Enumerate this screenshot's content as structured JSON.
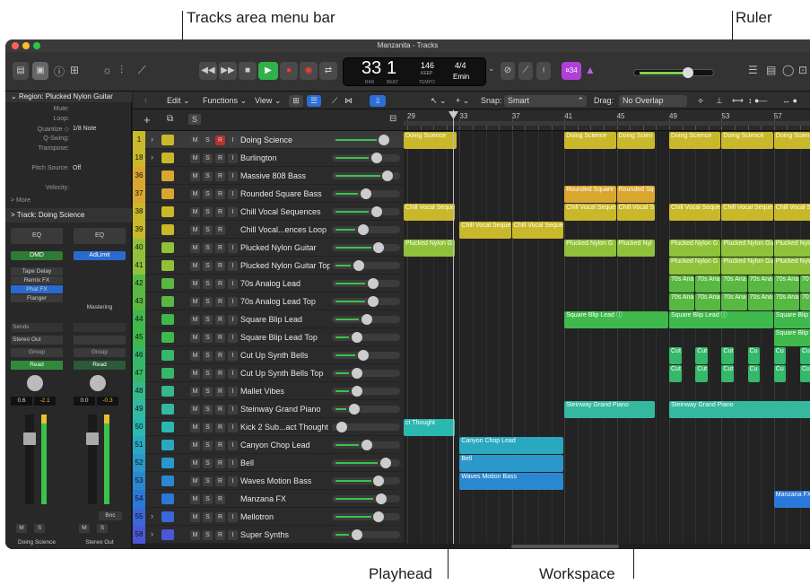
{
  "callouts": {
    "tracks_menu": "Tracks area menu bar",
    "ruler": "Ruler",
    "playhead": "Playhead",
    "workspace": "Workspace"
  },
  "window": {
    "title": "Manzanita - Tracks"
  },
  "lcd": {
    "bar": "33",
    "beat_pos": "1",
    "bar_label": "BAR",
    "beat_label": "BEAT",
    "tempo": "146",
    "tempo_mode": "KEEP",
    "tempo_label": "TEMPO",
    "time_sig": "4/4",
    "key": "Emin"
  },
  "toolbar": {
    "count_in": "¤34"
  },
  "inspector": {
    "region_title": "Region: Plucked Nylon Guitar",
    "rows": [
      {
        "k": "Mute:",
        "v": ""
      },
      {
        "k": "Loop:",
        "v": ""
      },
      {
        "k": "Quantize ◇",
        "v": "1/8 Note"
      },
      {
        "k": "Q-Swing:",
        "v": ""
      },
      {
        "k": "Transpose:",
        "v": ""
      },
      {
        "k": "",
        "v": ""
      },
      {
        "k": "Pitch Source:",
        "v": "Off"
      },
      {
        "k": "",
        "v": ""
      },
      {
        "k": "Velocity:",
        "v": ""
      }
    ],
    "more": "> More",
    "track_title": "Track: Doing Science",
    "strips": [
      {
        "eq": "EQ",
        "plugin": "DMD",
        "inserts": [
          "Tape Delay",
          "Remix FX",
          "Phat FX",
          "Flanger"
        ],
        "sends": "Sends",
        "output": "Stereo Out",
        "group": "Group",
        "auto": "Read",
        "pan_l": "0.6",
        "pan_r": "-2.1",
        "m": "M",
        "s": "S",
        "name": "Doing Science"
      },
      {
        "eq": "EQ",
        "plugin": "AdLimit",
        "inserts": [
          "Mastering"
        ],
        "sends": "",
        "output": "",
        "group": "Group",
        "auto": "Read",
        "pan_l": "0.0",
        "pan_r": "-0.3",
        "bnc": "Bnc",
        "m": "M",
        "s": "S",
        "name": "Stereo Out"
      }
    ]
  },
  "menubar": {
    "edit": "Edit",
    "functions": "Functions",
    "view": "View",
    "snap_label": "Snap:",
    "snap_value": "Smart",
    "drag_label": "Drag:",
    "drag_value": "No Overlap"
  },
  "header_buttons": {
    "add": "+",
    "s": "S"
  },
  "ruler": {
    "bars": [
      "29",
      "33",
      "37",
      "41",
      "45",
      "49",
      "53",
      "57"
    ]
  },
  "tracks": [
    {
      "num": "1",
      "name": "Doing Science",
      "color": "#c9b82a",
      "btns": [
        "M",
        "S",
        "R",
        "I"
      ],
      "fold": true,
      "vol": 0.82
    },
    {
      "num": "18",
      "name": "Burlington",
      "color": "#c9b82a",
      "btns": [
        "M",
        "S",
        "R",
        "I"
      ],
      "fold": true,
      "vol": 0.68
    },
    {
      "num": "36",
      "name": "Massive 808 Bass",
      "color": "#d9a730",
      "btns": [
        "M",
        "S",
        "R",
        "I"
      ],
      "vol": 0.88
    },
    {
      "num": "37",
      "name": "Rounded Square Bass",
      "color": "#d9a730",
      "btns": [
        "M",
        "S",
        "R",
        "I"
      ],
      "vol": 0.5
    },
    {
      "num": "38",
      "name": "Chill Vocal Sequences",
      "color": "#c9b82a",
      "btns": [
        "M",
        "S",
        "R",
        "I"
      ],
      "vol": 0.68
    },
    {
      "num": "39",
      "name": "Chill Vocal...ences Loop",
      "color": "#c9b82a",
      "btns": [
        "M",
        "S",
        "R"
      ],
      "vol": 0.45
    },
    {
      "num": "40",
      "name": "Plucked Nylon Guitar",
      "color": "#8fc23a",
      "btns": [
        "M",
        "S",
        "R",
        "I"
      ],
      "vol": 0.72
    },
    {
      "num": "41",
      "name": "Plucked Nylon Guitar Top",
      "color": "#8fc23a",
      "btns": [
        "M",
        "S",
        "R",
        "I"
      ],
      "vol": 0.38
    },
    {
      "num": "42",
      "name": "70s Analog Lead",
      "color": "#59b842",
      "btns": [
        "M",
        "S",
        "R",
        "I"
      ],
      "vol": 0.62
    },
    {
      "num": "43",
      "name": "70s Analog Lead Top",
      "color": "#59b842",
      "btns": [
        "M",
        "S",
        "R",
        "I"
      ],
      "vol": 0.62
    },
    {
      "num": "44",
      "name": "Square Blip Lead",
      "color": "#3fb84c",
      "btns": [
        "M",
        "S",
        "R",
        "I"
      ],
      "vol": 0.52
    },
    {
      "num": "45",
      "name": "Square Blip Lead Top",
      "color": "#3fb84c",
      "btns": [
        "M",
        "S",
        "R",
        "I"
      ],
      "vol": 0.35
    },
    {
      "num": "46",
      "name": "Cut Up Synth Bells",
      "color": "#35b86a",
      "btns": [
        "M",
        "S",
        "R",
        "I"
      ],
      "vol": 0.45
    },
    {
      "num": "47",
      "name": "Cut Up Synth Bells Top",
      "color": "#35b86a",
      "btns": [
        "M",
        "S",
        "R",
        "I"
      ],
      "vol": 0.35
    },
    {
      "num": "48",
      "name": "Mallet Vibes",
      "color": "#35b88a",
      "btns": [
        "M",
        "S",
        "R",
        "I"
      ],
      "vol": 0.35
    },
    {
      "num": "49",
      "name": "Steinway Grand Piano",
      "color": "#35b8a0",
      "btns": [
        "M",
        "S",
        "R",
        "I"
      ],
      "vol": 0.3
    },
    {
      "num": "50",
      "name": "Kick 2 Sub...act Thought",
      "color": "#2ab8b0",
      "btns": [
        "M",
        "S",
        "R",
        "I"
      ],
      "vol": 0.08
    },
    {
      "num": "51",
      "name": "Canyon Chop Lead",
      "color": "#2aa8c0",
      "btns": [
        "M",
        "S",
        "R",
        "I"
      ],
      "vol": 0.52
    },
    {
      "num": "52",
      "name": "Bell",
      "color": "#2a98c8",
      "btns": [
        "M",
        "S",
        "R",
        "I"
      ],
      "vol": 0.84
    },
    {
      "num": "53",
      "name": "Waves Motion Bass",
      "color": "#2a88d0",
      "btns": [
        "M",
        "S",
        "R",
        "I"
      ],
      "vol": 0.72
    },
    {
      "num": "54",
      "name": "Manzana FX",
      "color": "#2a78d8",
      "btns": [
        "M",
        "S",
        "R"
      ],
      "vol": 0.76
    },
    {
      "num": "55",
      "name": "Mellotron",
      "color": "#3a68d8",
      "btns": [
        "M",
        "S",
        "R",
        "I"
      ],
      "fold": true,
      "vol": 0.72
    },
    {
      "num": "58",
      "name": "Super Synths",
      "color": "#4a58d8",
      "btns": [
        "M",
        "S",
        "R",
        "I"
      ],
      "fold": true,
      "vol": 0.35
    }
  ],
  "regions": [
    {
      "row": 0,
      "bar": 29,
      "len": 4.1,
      "label": "Doing Science",
      "color": "#c9b82a"
    },
    {
      "row": 0,
      "bar": 41,
      "len": 4,
      "label": "Doing Science",
      "color": "#c9b82a"
    },
    {
      "row": 0,
      "bar": 45,
      "len": 3,
      "label": "Doing Scien",
      "color": "#c9b82a"
    },
    {
      "row": 0,
      "bar": 49,
      "len": 4,
      "label": "Doing Science",
      "color": "#c9b82a"
    },
    {
      "row": 0,
      "bar": 53,
      "len": 4,
      "label": "Doing Science",
      "color": "#c9b82a"
    },
    {
      "row": 0,
      "bar": 57,
      "len": 3,
      "label": "Doing Scien",
      "color": "#c9b82a"
    },
    {
      "row": 3,
      "bar": 41,
      "len": 4,
      "label": "Rounded Square",
      "color": "#d9a730"
    },
    {
      "row": 3,
      "bar": 45,
      "len": 3,
      "label": "Rounded Sq",
      "color": "#d9a730"
    },
    {
      "row": 4,
      "bar": 29,
      "len": 4,
      "label": "Chill Vocal Seque",
      "color": "#c9b82a"
    },
    {
      "row": 4,
      "bar": 41,
      "len": 4,
      "label": "Chill Vocal Seque",
      "color": "#c9b82a"
    },
    {
      "row": 4,
      "bar": 45,
      "len": 3,
      "label": "Chill Vocal S",
      "color": "#c9b82a"
    },
    {
      "row": 4,
      "bar": 49,
      "len": 4,
      "label": "Chill Vocal Seque",
      "color": "#c9b82a"
    },
    {
      "row": 4,
      "bar": 53,
      "len": 4,
      "label": "Chill Vocal Seque",
      "color": "#c9b82a"
    },
    {
      "row": 4,
      "bar": 57,
      "len": 3,
      "label": "Chill Vocal S",
      "color": "#c9b82a"
    },
    {
      "row": 5,
      "bar": 33,
      "len": 4,
      "label": "Chill Vocal Seque",
      "color": "#c9b82a"
    },
    {
      "row": 5,
      "bar": 37,
      "len": 4,
      "label": "Chill Vocal Seque",
      "color": "#c9b82a"
    },
    {
      "row": 6,
      "bar": 29,
      "len": 4,
      "label": "Plucked Nylon G",
      "color": "#8fc23a"
    },
    {
      "row": 6,
      "bar": 41,
      "len": 4,
      "label": "Plucked Nylon G",
      "color": "#8fc23a"
    },
    {
      "row": 6,
      "bar": 45,
      "len": 3,
      "label": "Plucked Nyl",
      "color": "#8fc23a"
    },
    {
      "row": 6,
      "bar": 49,
      "len": 4,
      "label": "Plucked Nylon G",
      "color": "#8fc23a"
    },
    {
      "row": 6,
      "bar": 53,
      "len": 4,
      "label": "Plucked Nylon Gu",
      "color": "#8fc23a"
    },
    {
      "row": 6,
      "bar": 57,
      "len": 3,
      "label": "Plucked Nylon",
      "color": "#8fc23a"
    },
    {
      "row": 7,
      "bar": 49,
      "len": 4,
      "label": "Plucked Nylon G",
      "color": "#8fc23a"
    },
    {
      "row": 7,
      "bar": 53,
      "len": 4,
      "label": "Plucked Nylon Gu",
      "color": "#8fc23a"
    },
    {
      "row": 7,
      "bar": 57,
      "len": 3,
      "label": "Plucked Nylon",
      "color": "#8fc23a"
    },
    {
      "row": 8,
      "bar": 49,
      "len": 2,
      "label": "70s Ana",
      "color": "#59b842"
    },
    {
      "row": 8,
      "bar": 51,
      "len": 2,
      "label": "70s Ana",
      "color": "#59b842"
    },
    {
      "row": 8,
      "bar": 53,
      "len": 2,
      "label": "70s Ana",
      "color": "#59b842"
    },
    {
      "row": 8,
      "bar": 55,
      "len": 2,
      "label": "70s Ana",
      "color": "#59b842"
    },
    {
      "row": 8,
      "bar": 57,
      "len": 2,
      "label": "70s Ana",
      "color": "#59b842"
    },
    {
      "row": 8,
      "bar": 59,
      "len": 1,
      "label": "70",
      "color": "#59b842"
    },
    {
      "row": 9,
      "bar": 49,
      "len": 2,
      "label": "70s Ana",
      "color": "#59b842"
    },
    {
      "row": 9,
      "bar": 51,
      "len": 2,
      "label": "70s Ana",
      "color": "#59b842"
    },
    {
      "row": 9,
      "bar": 53,
      "len": 2,
      "label": "70s Ana",
      "color": "#59b842"
    },
    {
      "row": 9,
      "bar": 55,
      "len": 2,
      "label": "70s Ana",
      "color": "#59b842"
    },
    {
      "row": 9,
      "bar": 57,
      "len": 2,
      "label": "70s Ana",
      "color": "#59b842"
    },
    {
      "row": 9,
      "bar": 59,
      "len": 1,
      "label": "70",
      "color": "#59b842"
    },
    {
      "row": 10,
      "bar": 41,
      "len": 8,
      "label": "Square Blip Lead ⓘ",
      "color": "#3fb84c"
    },
    {
      "row": 10,
      "bar": 49,
      "len": 8,
      "label": "Square Blip Lead ⓘ",
      "color": "#3fb84c"
    },
    {
      "row": 10,
      "bar": 57,
      "len": 3,
      "label": "Square Blip",
      "color": "#3fb84c"
    },
    {
      "row": 11,
      "bar": 57,
      "len": 3,
      "label": "Square Blip",
      "color": "#3fb84c"
    },
    {
      "row": 12,
      "bar": 49,
      "len": 1,
      "label": "Cut",
      "color": "#35b86a"
    },
    {
      "row": 12,
      "bar": 51,
      "len": 1,
      "label": "Cut",
      "color": "#35b86a"
    },
    {
      "row": 12,
      "bar": 53,
      "len": 1,
      "label": "Cut",
      "color": "#35b86a"
    },
    {
      "row": 12,
      "bar": 55,
      "len": 1,
      "label": "Cu",
      "color": "#35b86a"
    },
    {
      "row": 12,
      "bar": 57,
      "len": 1,
      "label": "Cu",
      "color": "#35b86a"
    },
    {
      "row": 12,
      "bar": 59,
      "len": 1,
      "label": "Cu",
      "color": "#35b86a"
    },
    {
      "row": 13,
      "bar": 49,
      "len": 1,
      "label": "Cut",
      "color": "#35b86a"
    },
    {
      "row": 13,
      "bar": 51,
      "len": 1,
      "label": "Cut",
      "color": "#35b86a"
    },
    {
      "row": 13,
      "bar": 53,
      "len": 1,
      "label": "Cut",
      "color": "#35b86a"
    },
    {
      "row": 13,
      "bar": 55,
      "len": 1,
      "label": "Cu",
      "color": "#35b86a"
    },
    {
      "row": 13,
      "bar": 57,
      "len": 1,
      "label": "Cu",
      "color": "#35b86a"
    },
    {
      "row": 13,
      "bar": 59,
      "len": 1,
      "label": "Cu",
      "color": "#35b86a"
    },
    {
      "row": 15,
      "bar": 41,
      "len": 7,
      "label": "Steinway Grand Piano",
      "color": "#35b8a0"
    },
    {
      "row": 15,
      "bar": 49,
      "len": 11,
      "label": "Steinway Grand Piano",
      "color": "#35b8a0"
    },
    {
      "row": 16,
      "bar": 29,
      "len": 4,
      "label": "ct Thought",
      "color": "#2ab8b0"
    },
    {
      "row": 17,
      "bar": 33,
      "len": 8,
      "label": "Canyon Chop Lead",
      "color": "#2aa8c0"
    },
    {
      "row": 18,
      "bar": 33,
      "len": 8,
      "label": "Bell",
      "color": "#2a98c8"
    },
    {
      "row": 19,
      "bar": 33,
      "len": 8,
      "label": "Waves Motion Bass",
      "color": "#2a88d0"
    },
    {
      "row": 20,
      "bar": 57,
      "len": 3,
      "label": "Manzana FX",
      "color": "#2a78d8"
    }
  ]
}
